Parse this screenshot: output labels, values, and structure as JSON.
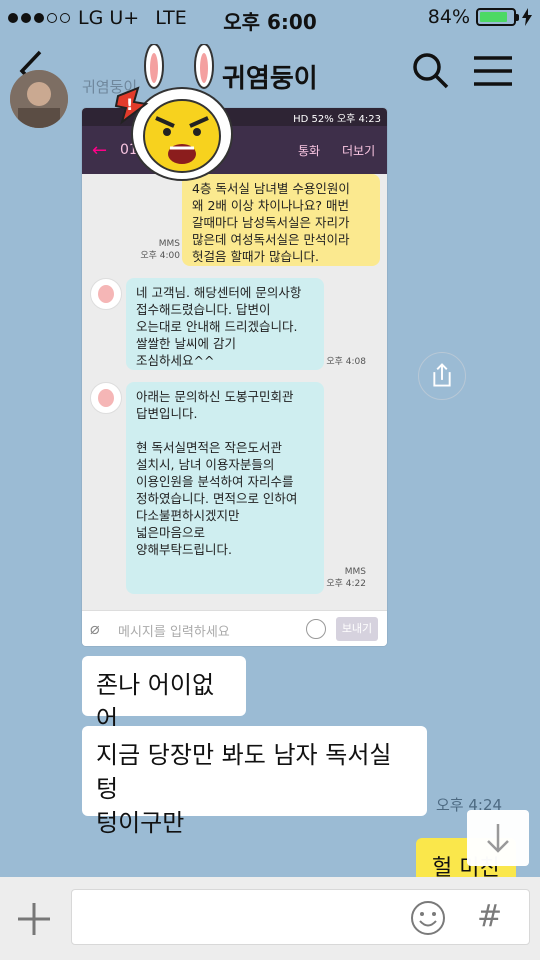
{
  "status": {
    "carrier": "LG U+",
    "network": "LTE",
    "time": "오후 6:00",
    "battery": "84%",
    "battery_level": 0.84
  },
  "header": {
    "title": "귀염둥이",
    "sender_name": "귀염둥이"
  },
  "embedded_screenshot": {
    "status_text": "HD 52% 오후 4:23",
    "phone_number": "010-",
    "call_label": "통화",
    "more_label": "더보기",
    "messages": [
      {
        "text": "4층 독서실 남녀별 수용인원이\n왜 2배 이상 차이나나요? 매번\n갈때마다 남성독서실은 자리가\n많은데 여성독서실은 만석이라\n헛걸음 할때가 많습니다.",
        "type": "MMS",
        "time": "오후 4:00"
      },
      {
        "text": "네 고객님. 해당센터에 문의사항\n접수해드렸습니다. 답변이\n오는대로  안내해 드리겠습니다.\n쌀쌀한 날씨에 감기\n조심하세요^^",
        "time": "오후 4:08"
      },
      {
        "text": "아래는 문의하신 도봉구민회관\n답변입니다.\n\n현 독서실면적은 작은도서관\n설치시, 남녀 이용자분들의\n이용인원을 분석하여 자리수를\n정하였습니다. 면적으로 인하여\n다소불편하시겠지만\n넓은마음으로\n양해부탁드립니다.",
        "type": "MMS",
        "time": "오후 4:22"
      }
    ],
    "input_placeholder": "메시지를 입력하세요",
    "send_label": "보내기"
  },
  "chat": {
    "messages": [
      {
        "text": "존나 어이없어"
      },
      {
        "text": "지금 당장만 봐도 남자 독서실 텅\n텅이구만"
      }
    ],
    "time": "오후 4:24",
    "my_message": "헐 미친"
  },
  "colors": {
    "chat_bg": "#9bbbd4",
    "my_bubble": "#fae74b",
    "battery_fill": "#4cd964"
  }
}
